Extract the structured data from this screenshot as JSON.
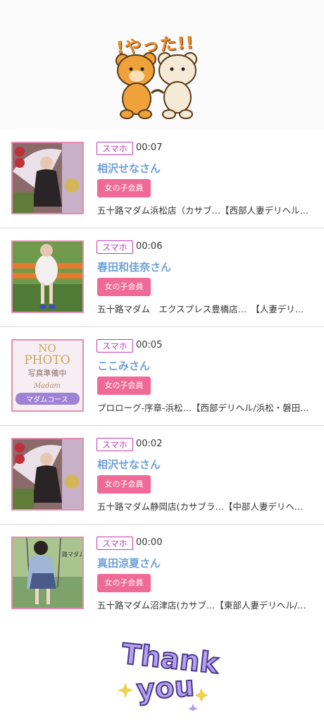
{
  "top_banner": {
    "caption": "!やった!!"
  },
  "rows": [
    {
      "badge": "スマホ",
      "time": "00:07",
      "name": "相沢せなさん",
      "member": "女の子会員",
      "shop": "五十路マダム浜松店（カサブ…【西部人妻デリヘル…",
      "thumb": "photo-umbrella"
    },
    {
      "badge": "スマホ",
      "time": "00:06",
      "name": "春田和佳奈さん",
      "member": "女の子会員",
      "shop": "五十路マダム　エクスプレス豊橋店…　【人妻デリ…",
      "thumb": "photo-bench"
    },
    {
      "badge": "スマホ",
      "time": "00:05",
      "name": "ここみさん",
      "member": "女の子会員",
      "shop": "プロローグ-序章-浜松…【西部デリヘル/浜松・磐田…",
      "thumb": "no-photo",
      "nophoto": {
        "line1": "NO",
        "line2": "PHOTO",
        "line3": "写真準備中",
        "line4": "Madam",
        "line5": "マダムコース"
      }
    },
    {
      "badge": "スマホ",
      "time": "00:02",
      "name": "相沢せなさん",
      "member": "女の子会員",
      "shop": "五十路マダム静岡店(カサブラ…【中部人妻デリヘ…",
      "thumb": "photo-umbrella"
    },
    {
      "badge": "スマホ",
      "time": "00:00",
      "name": "真田涼夏さん",
      "member": "女の子会員",
      "shop": "五十路マダム沼津店(カサブ…【東部人妻デリヘル/…",
      "thumb": "photo-swing"
    }
  ],
  "bottom_banner": {
    "line1": "Thank",
    "line2": "you"
  },
  "colors": {
    "badge": "#c23bb7",
    "name": "#6fa0d8",
    "member": "#f06a98",
    "thumb_border": "#e58cb0"
  }
}
